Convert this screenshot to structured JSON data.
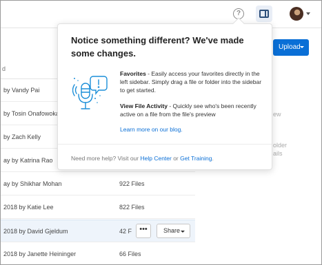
{
  "header": {
    "help_icon_glyph": "?",
    "icons": [
      "help-icon",
      "sidebar-toggle-icon",
      "user-avatar"
    ]
  },
  "toolbar": {
    "upload_label": "Upload"
  },
  "list": {
    "column_header": "d",
    "rows": [
      {
        "owner": "by Vandy Pai",
        "count": ""
      },
      {
        "owner": "by Tosin Onafowokan",
        "count": ""
      },
      {
        "owner": "by Zach Kelly",
        "count": ""
      },
      {
        "owner": "ay by Katrina Rao",
        "count": ""
      },
      {
        "owner": "ay by Shikhar Mohan",
        "count": "922 Files"
      },
      {
        "owner": "2018 by Katie Lee",
        "count": "822 Files"
      },
      {
        "owner": "2018 by David Gjeldum",
        "count": "42 F"
      },
      {
        "owner": "2018 by Janette Heininger",
        "count": "66 Files"
      }
    ],
    "more_label": "•••",
    "share_label": "Share",
    "right_fragments": [
      "ew",
      "older",
      "ails"
    ]
  },
  "popover": {
    "title": "Notice something different? We've made some changes.",
    "feature1_name": "Favorites",
    "feature1_text": " - Easily access your favorites directly in the left sidebar. Simply drag a file or folder into the sidebar to get started.",
    "feature2_name": "View File Activity",
    "feature2_text": " - Quickly see who's been recently active on a file from the file's preview",
    "learn_more": "Learn more on our blog.",
    "footer_prefix": "Need more help? Visit our ",
    "footer_link1": "Help Center",
    "footer_mid": " or ",
    "footer_link2": "Get Training",
    "footer_suffix": "."
  },
  "colors": {
    "accent": "#0a6fd6",
    "illustration": "#1a8ed8",
    "selected_row": "#eef4fb"
  }
}
